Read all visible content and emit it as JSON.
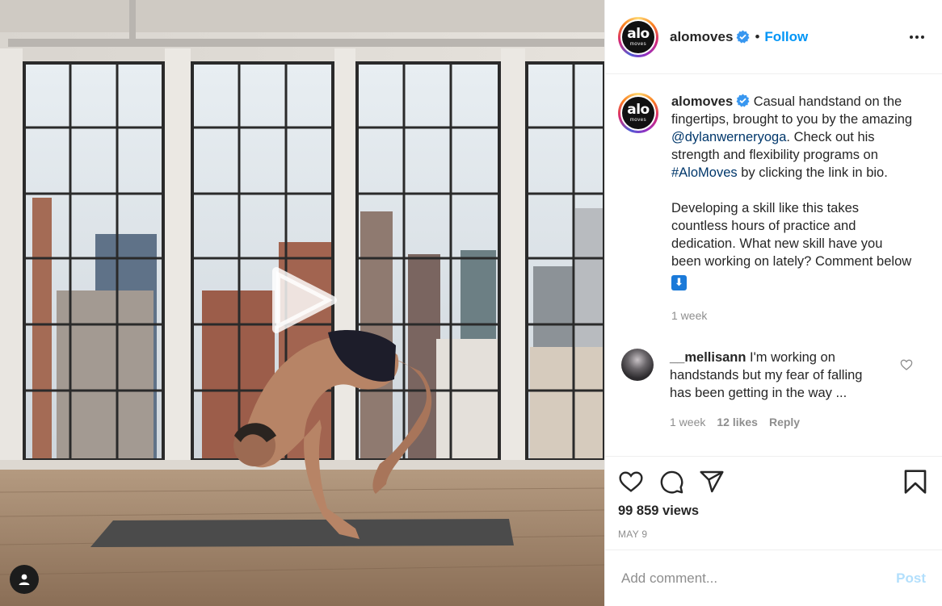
{
  "post": {
    "author": {
      "username": "alomoves",
      "logo_text": "alo",
      "logo_subtext": "moves",
      "verified": true
    },
    "header": {
      "separator": "•",
      "follow_label": "Follow",
      "more_icon": "more-horizontal-icon"
    },
    "caption": {
      "username": "alomoves",
      "text_1": " Casual handstand on the fingertips, brought to you by the amazing ",
      "mention": "@dylanwerneryoga",
      "text_2": ". Check out his strength and flexibility programs on ",
      "hashtag": "#AloMoves",
      "text_3": " by clicking the link in bio.",
      "paragraph_2": "Developing a skill like this takes countless hours of practice and dedication. What new skill have you been working on lately? Comment below ",
      "emoji": "⬇",
      "timestamp": "1 week"
    },
    "comments": [
      {
        "username": "__mellisann",
        "text": " I'm working on handstands but my fear of falling has been getting in the way ...",
        "timestamp": "1 week",
        "likes": "12 likes",
        "reply_label": "Reply"
      }
    ],
    "actions": {
      "icons": [
        "heart-icon",
        "comment-icon",
        "share-icon",
        "bookmark-icon"
      ],
      "views": "99 859 views",
      "date": "MAY 9"
    },
    "add_comment": {
      "placeholder": "Add comment...",
      "post_label": "Post"
    },
    "colors": {
      "accent": "#0095f6",
      "link": "#00376b",
      "muted": "#8e8e8e",
      "post_disabled": "#b2dffc",
      "verified": "#3897f0"
    }
  }
}
